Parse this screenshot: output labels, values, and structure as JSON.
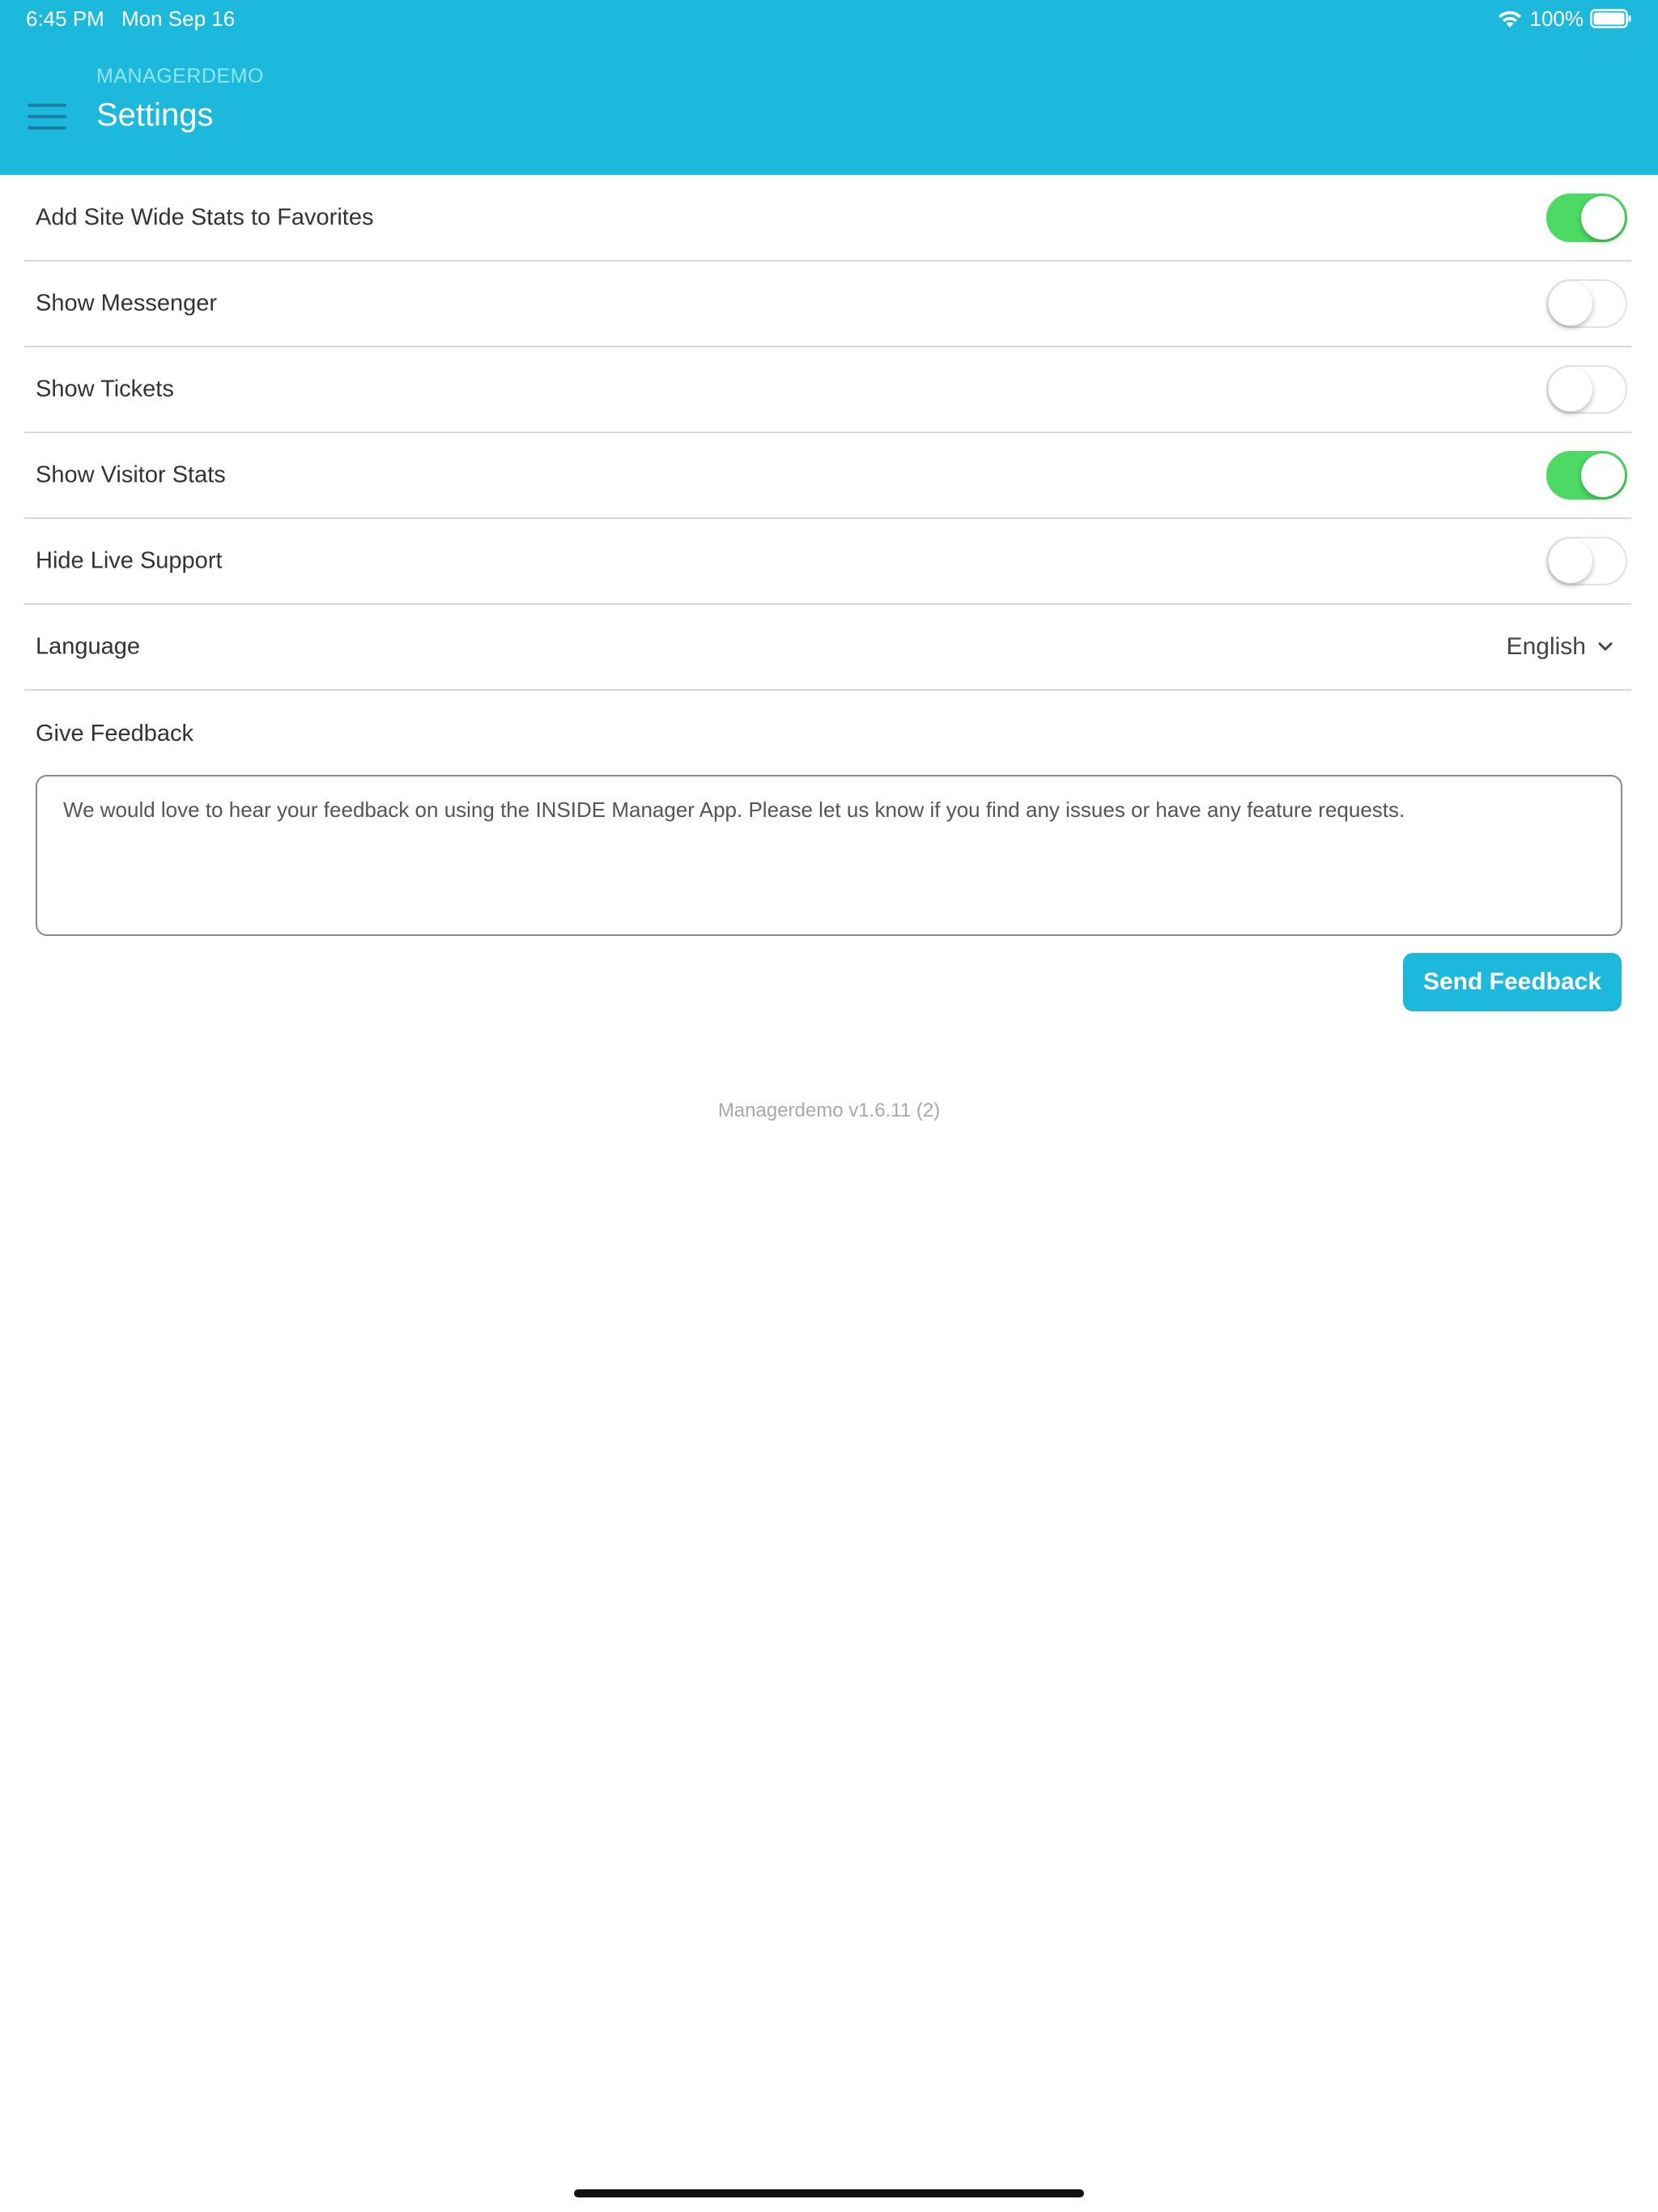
{
  "colors": {
    "brand": "#1cb9dc",
    "toggle_on": "#4cd964",
    "text": "#333333"
  },
  "status_bar": {
    "time": "6:45 PM",
    "date": "Mon Sep 16",
    "battery": "100%",
    "icons": [
      "wifi-icon",
      "battery-icon"
    ]
  },
  "header": {
    "app_name": "MANAGERDEMO",
    "title": "Settings",
    "menu_icon": "hamburger-menu-icon"
  },
  "settings": [
    {
      "label": "Add Site Wide Stats to Favorites",
      "enabled": true
    },
    {
      "label": "Show Messenger",
      "enabled": false
    },
    {
      "label": "Show Tickets",
      "enabled": false
    },
    {
      "label": "Show Visitor Stats",
      "enabled": true
    },
    {
      "label": "Hide Live Support",
      "enabled": false
    }
  ],
  "language": {
    "label": "Language",
    "value": "English"
  },
  "feedback": {
    "label": "Give Feedback",
    "text": "We would love to hear your feedback on using the INSIDE Manager App. Please let us know if you find any issues or have any feature requests.",
    "button_label": "Send Feedback"
  },
  "version": "Managerdemo v1.6.11 (2)"
}
